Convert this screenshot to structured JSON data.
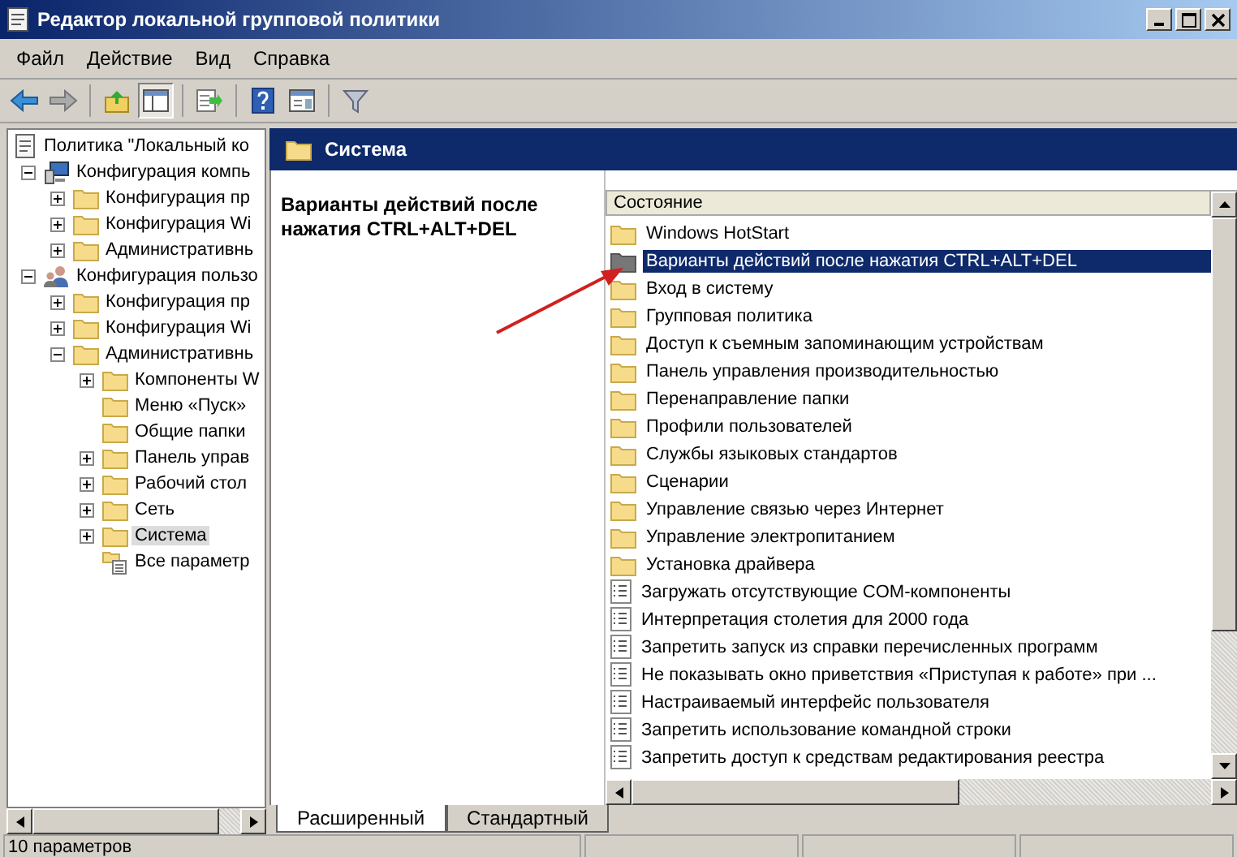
{
  "window": {
    "title": "Редактор локальной групповой политики"
  },
  "menu": [
    "Файл",
    "Действие",
    "Вид",
    "Справка"
  ],
  "toolbar": [
    {
      "kind": "back",
      "pressed": false
    },
    {
      "kind": "forward",
      "pressed": false
    },
    {
      "kind": "up",
      "pressed": false
    },
    {
      "kind": "tree",
      "pressed": true
    },
    {
      "kind": "export",
      "pressed": false
    },
    {
      "kind": "help",
      "pressed": false
    },
    {
      "kind": "properties",
      "pressed": false
    },
    {
      "kind": "filter",
      "pressed": false
    }
  ],
  "tree": [
    {
      "label": "Политика \"Локальный ко",
      "kind": "policy",
      "selected": false,
      "children": [
        {
          "label": "Конфигурация компь",
          "kind": "computer",
          "expanded": true,
          "selected": false,
          "children": [
            {
              "label": "Конфигурация пр",
              "kind": "folder",
              "expanded": false,
              "selected": false
            },
            {
              "label": "Конфигурация Wi",
              "kind": "folder",
              "expanded": false,
              "selected": false
            },
            {
              "label": "Административнь",
              "kind": "folder",
              "expanded": false,
              "selected": false
            }
          ]
        },
        {
          "label": "Конфигурация пользо",
          "kind": "user",
          "expanded": true,
          "selected": false,
          "children": [
            {
              "label": "Конфигурация пр",
              "kind": "folder",
              "expanded": false,
              "selected": false
            },
            {
              "label": "Конфигурация Wi",
              "kind": "folder",
              "expanded": false,
              "selected": false
            },
            {
              "label": "Административнь",
              "kind": "folder",
              "expanded": true,
              "selected": false,
              "children": [
                {
                  "label": "Компоненты W",
                  "kind": "folder",
                  "expanded": false,
                  "selected": false
                },
                {
                  "label": "Меню «Пуск»",
                  "kind": "folder",
                  "selected": false
                },
                {
                  "label": "Общие папки",
                  "kind": "folder",
                  "selected": false
                },
                {
                  "label": "Панель управ",
                  "kind": "folder",
                  "expanded": false,
                  "selected": false
                },
                {
                  "label": "Рабочий стол",
                  "kind": "folder",
                  "expanded": false,
                  "selected": false
                },
                {
                  "label": "Сеть",
                  "kind": "folder",
                  "expanded": false,
                  "selected": false
                },
                {
                  "label": "Система",
                  "kind": "folder",
                  "expanded": false,
                  "selected": true
                },
                {
                  "label": "Все параметр",
                  "kind": "settings",
                  "selected": false
                }
              ]
            }
          ]
        }
      ]
    }
  ],
  "header": {
    "title": "Система"
  },
  "description": {
    "title": "Варианты действий после нажатия CTRL+ALT+DEL"
  },
  "list": {
    "column": "Состояние",
    "rows": [
      {
        "label": "Windows HotStart",
        "kind": "folder",
        "selected": false
      },
      {
        "label": "Варианты действий после нажатия CTRL+ALT+DEL",
        "kind": "folder",
        "selected": true
      },
      {
        "label": "Вход в систему",
        "kind": "folder",
        "selected": false
      },
      {
        "label": "Групповая политика",
        "kind": "folder",
        "selected": false
      },
      {
        "label": "Доступ к съемным запоминающим устройствам",
        "kind": "folder",
        "selected": false
      },
      {
        "label": "Панель управления производительностью",
        "kind": "folder",
        "selected": false
      },
      {
        "label": "Перенаправление папки",
        "kind": "folder",
        "selected": false
      },
      {
        "label": "Профили пользователей",
        "kind": "folder",
        "selected": false
      },
      {
        "label": "Службы языковых стандартов",
        "kind": "folder",
        "selected": false
      },
      {
        "label": "Сценарии",
        "kind": "folder",
        "selected": false
      },
      {
        "label": "Управление связью через Интернет",
        "kind": "folder",
        "selected": false
      },
      {
        "label": "Управление электропитанием",
        "kind": "folder",
        "selected": false
      },
      {
        "label": "Установка драйвера",
        "kind": "folder",
        "selected": false
      },
      {
        "label": "Загружать отсутствующие COM-компоненты",
        "kind": "setting",
        "selected": false
      },
      {
        "label": "Интерпретация столетия для 2000 года",
        "kind": "setting",
        "selected": false
      },
      {
        "label": "Запретить запуск из справки перечисленных программ",
        "kind": "setting",
        "selected": false
      },
      {
        "label": "Не показывать окно приветствия «Приступая к работе» при ...",
        "kind": "setting",
        "selected": false
      },
      {
        "label": "Настраиваемый интерфейс пользователя",
        "kind": "setting",
        "selected": false
      },
      {
        "label": "Запретить использование командной строки",
        "kind": "setting",
        "selected": false
      },
      {
        "label": "Запретить доступ к средствам редактирования реестра",
        "kind": "setting",
        "selected": false
      }
    ]
  },
  "tabs": [
    {
      "label": "Расширенный",
      "selected": true
    },
    {
      "label": "Стандартный",
      "selected": false
    }
  ],
  "status_bar": {
    "text": "10 параметров"
  }
}
